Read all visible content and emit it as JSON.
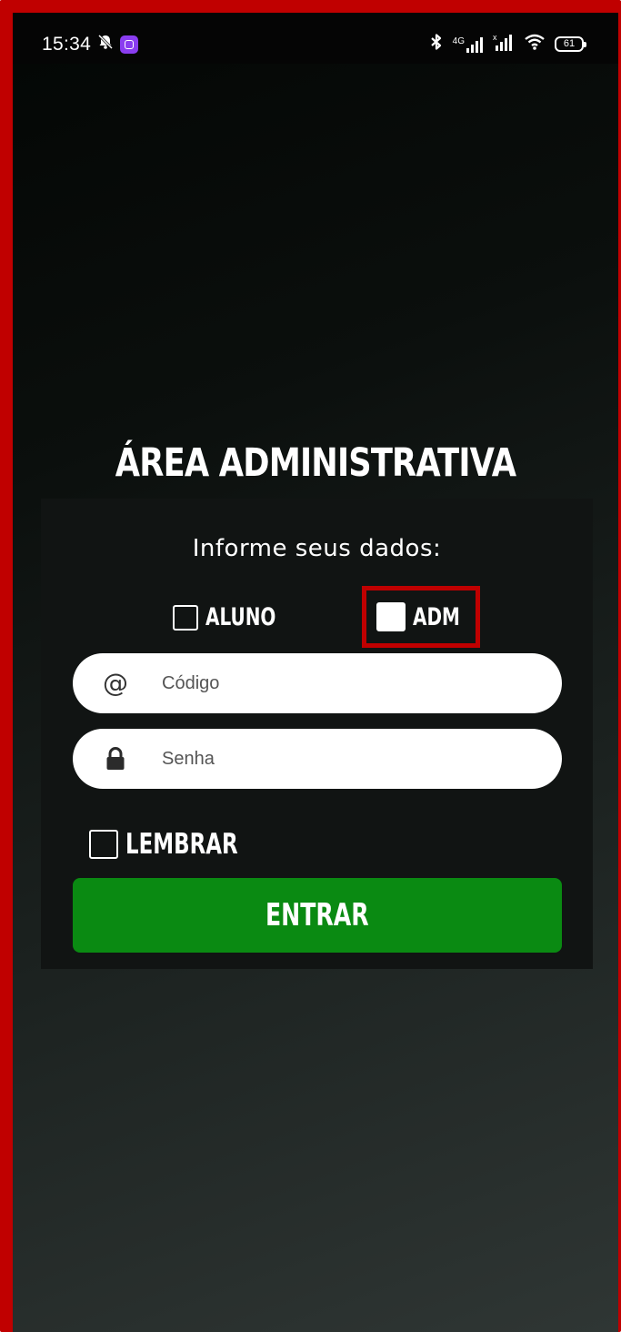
{
  "status_bar": {
    "time": "15:34",
    "left_icons": [
      "mute-bell-icon",
      "assistant-app-icon"
    ],
    "right_icons": [
      "bluetooth-icon",
      "signal-4g-icon",
      "signal-no-service-icon",
      "wifi-icon",
      "battery-icon"
    ],
    "signal_label": "4G",
    "battery_level": "61"
  },
  "page": {
    "title": "ÁREA ADMINISTRATIVA"
  },
  "form": {
    "subtitle": "Informe seus dados:",
    "role_options": [
      {
        "label": "ALUNO",
        "checked": false
      },
      {
        "label": "ADM",
        "checked": true
      }
    ],
    "code_field": {
      "placeholder": "Código",
      "value": "",
      "icon": "at-icon"
    },
    "password_field": {
      "placeholder": "Senha",
      "value": "",
      "icon": "lock-icon"
    },
    "remember": {
      "label": "LEMBRAR",
      "checked": false
    },
    "submit_label": "ENTRAR"
  },
  "colors": {
    "accent_green": "#0a8a12",
    "highlight_red": "#c00000",
    "card_background": "#111413"
  }
}
